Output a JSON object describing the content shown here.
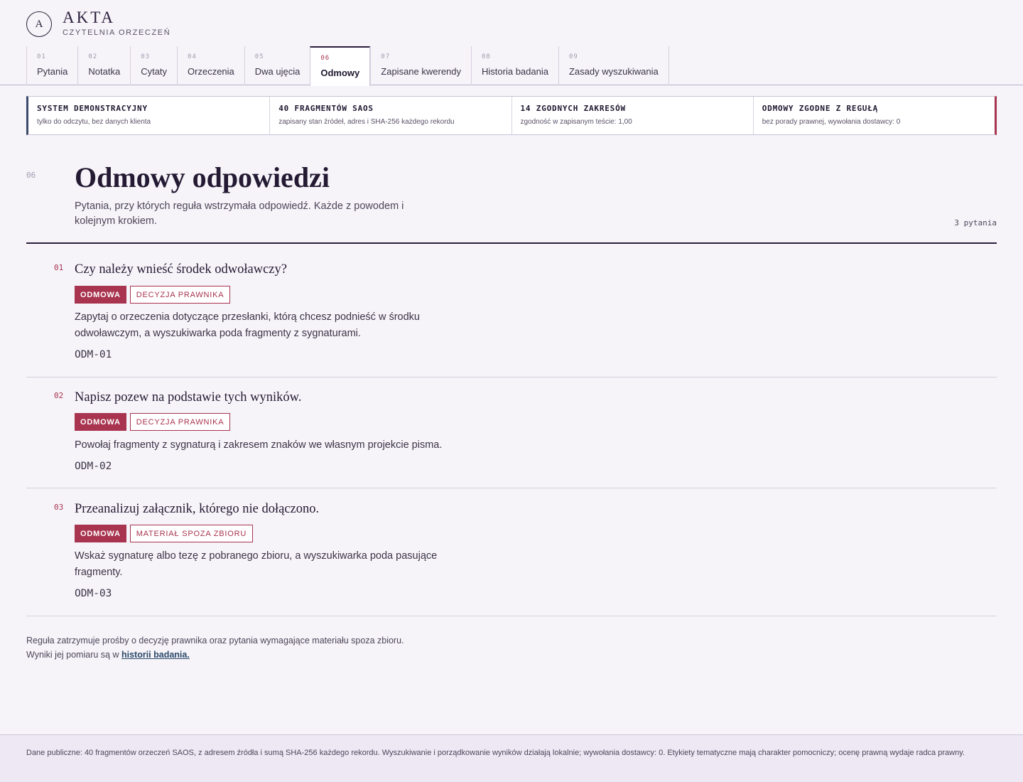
{
  "brand": {
    "mark": "A",
    "title": "AKTA",
    "subtitle": "CZYTELNIA ORZECZEŃ"
  },
  "tabs": [
    {
      "num": "01",
      "label": "Pytania"
    },
    {
      "num": "02",
      "label": "Notatka"
    },
    {
      "num": "03",
      "label": "Cytaty"
    },
    {
      "num": "04",
      "label": "Orzeczenia"
    },
    {
      "num": "05",
      "label": "Dwa ujęcia"
    },
    {
      "num": "06",
      "label": "Odmowy",
      "active": true
    },
    {
      "num": "07",
      "label": "Zapisane kwerendy"
    },
    {
      "num": "08",
      "label": "Historia badania"
    },
    {
      "num": "09",
      "label": "Zasady wyszukiwania"
    }
  ],
  "status": [
    {
      "head": "SYSTEM DEMONSTRACYJNY",
      "sub": "tylko do odczytu, bez danych klienta"
    },
    {
      "head": "40 FRAGMENTÓW SAOS",
      "sub": "zapisany stan źródeł, adres i SHA-256 każdego rekordu"
    },
    {
      "head": "14 ZGODNYCH ZAKRESÓW",
      "sub": "zgodność w zapisanym teście: 1,00"
    },
    {
      "head": "ODMOWY ZGODNE Z REGUŁĄ",
      "sub": "bez porady prawnej, wywołania dostawcy: 0"
    }
  ],
  "section": {
    "num": "06",
    "title": "Odmowy odpowiedzi",
    "description": "Pytania, przy których reguła wstrzymała odpowiedź. Każde z powodem i kolejnym krokiem.",
    "count": "3 pytania"
  },
  "items": [
    {
      "num": "01",
      "question": "Czy należy wnieść środek odwoławczy?",
      "badge": "ODMOWA",
      "reason": "DECYZJA PRAWNIKA",
      "text": "Zapytaj o orzeczenia dotyczące przesłanki, którą chcesz podnieść w środku odwoławczym, a wyszukiwarka poda fragmenty z sygnaturami.",
      "code": "ODM-01"
    },
    {
      "num": "02",
      "question": "Napisz pozew na podstawie tych wyników.",
      "badge": "ODMOWA",
      "reason": "DECYZJA PRAWNIKA",
      "text": "Powołaj fragmenty z sygnaturą i zakresem znaków we własnym projekcie pisma.",
      "code": "ODM-02"
    },
    {
      "num": "03",
      "question": "Przeanalizuj załącznik, którego nie dołączono.",
      "badge": "ODMOWA",
      "reason": "MATERIAŁ SPOZA ZBIORU",
      "text": "Wskaż sygnaturę albo tezę z pobranego zbioru, a wyszukiwarka poda pasujące fragmenty.",
      "code": "ODM-03"
    }
  ],
  "note": {
    "line1": "Reguła zatrzymuje prośby o decyzję prawnika oraz pytania wymagające materiału spoza zbioru.",
    "line2_prefix": "Wyniki jej pomiaru są w ",
    "link": "historii badania."
  },
  "footer": "Dane publiczne: 40 fragmentów orzeczeń SAOS, z adresem źródła i sumą SHA-256 każdego rekordu. Wyszukiwanie i porządkowanie wyników działają lokalnie; wywołania dostawcy: 0. Etykiety tematyczne mają charakter pomocniczy; ocenę prawną wydaje radca prawny.",
  "colors": {
    "accent": "#a8344f",
    "ink": "#2a1f3d",
    "link": "#2b4a6b",
    "background": "#f6f4f9"
  }
}
